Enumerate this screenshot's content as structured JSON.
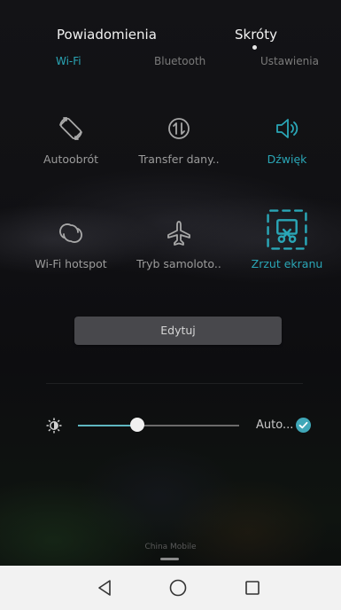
{
  "header": {
    "tab_notifications": "Powiadomienia",
    "tab_shortcuts": "Skróty"
  },
  "top_row": {
    "wifi": "Wi-Fi",
    "bluetooth": "Bluetooth",
    "settings": "Ustawienia"
  },
  "tiles": [
    {
      "label": "Autoobrót",
      "icon": "rotate-icon",
      "active": false
    },
    {
      "label": "Transfer dany..",
      "icon": "data-transfer-icon",
      "active": false
    },
    {
      "label": "Dźwięk",
      "icon": "sound-icon",
      "active": true
    },
    {
      "label": "Wi-Fi hotspot",
      "icon": "hotspot-icon",
      "active": false
    },
    {
      "label": "Tryb samoloto..",
      "icon": "airplane-icon",
      "active": false
    },
    {
      "label": "Zrzut ekranu",
      "icon": "screenshot-icon",
      "active": true
    }
  ],
  "edit_button": "Edytuj",
  "brightness": {
    "icon": "brightness-icon",
    "level": 0.37,
    "auto_label": "Auto...",
    "auto_checked": true
  },
  "carrier": "China Mobile",
  "colors": {
    "accent": "#2aa6b6",
    "label": "#9b9b9b",
    "navbar": "#f2f2f2"
  },
  "navbar": {
    "back_icon": "back-icon",
    "home_icon": "home-icon",
    "recents_icon": "recents-icon"
  }
}
